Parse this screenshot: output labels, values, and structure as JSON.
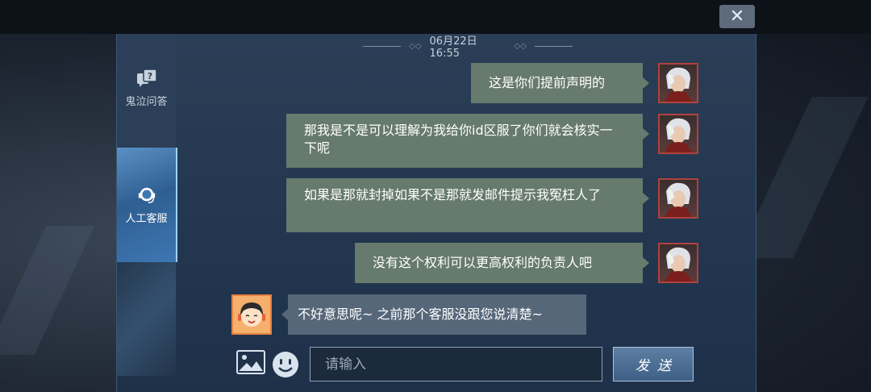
{
  "window": {
    "close_label": "✕"
  },
  "sidebar": {
    "tabs": [
      {
        "label": "鬼泣问答",
        "icon": "qa-icon"
      },
      {
        "label": "人工客服",
        "icon": "headset-icon",
        "active": true
      }
    ]
  },
  "chat": {
    "timestamp": "06月22日 16:55",
    "messages": [
      {
        "from": "user",
        "text": "这是你们提前声明的"
      },
      {
        "from": "user",
        "text": "那我是不是可以理解为我给你id区服了你们就会核实一下呢"
      },
      {
        "from": "user",
        "text": "如果是那就封掉如果不是那就发邮件提示我冤枉人了"
      },
      {
        "from": "user",
        "text": "没有这个权利可以更高权利的负责人吧"
      },
      {
        "from": "agent",
        "text": "不好意思呢~ 之前那个客服没跟您说清楚~"
      }
    ]
  },
  "composer": {
    "placeholder": "请输入",
    "value": "",
    "send_label": "发送",
    "image_icon": "image-icon",
    "emoji_icon": "emoji-icon"
  },
  "colors": {
    "user_bubble": "#667a6d",
    "agent_bubble": "#56677a",
    "panel": "#223650",
    "active_tab": "#3e77b3"
  }
}
